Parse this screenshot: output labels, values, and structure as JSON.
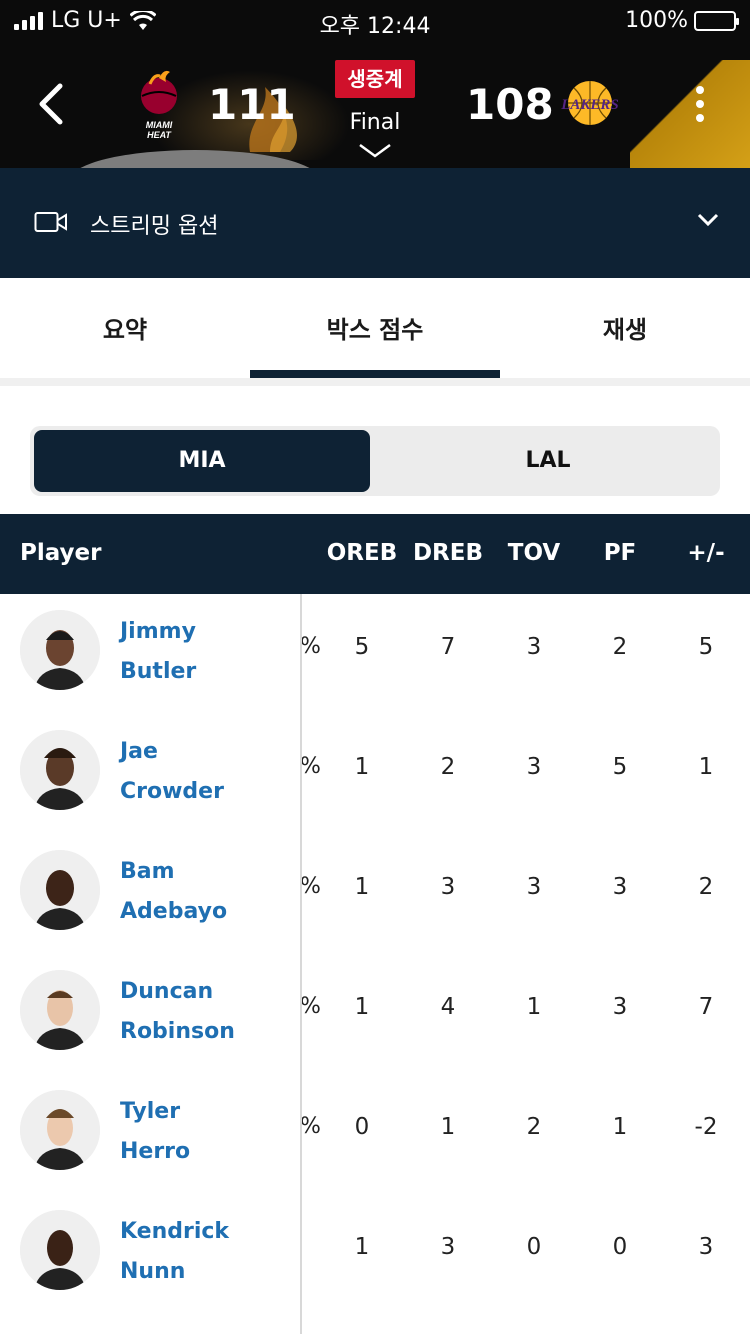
{
  "status_bar": {
    "carrier": "LG U+",
    "time": "오후 12:44",
    "battery": "100%"
  },
  "game": {
    "home_score": "111",
    "away_score": "108",
    "live_label": "생중계",
    "status": "Final",
    "home_team_logo": "miami-heat-logo",
    "home_logo_text_1": "MIAMI",
    "home_logo_text_2": "HEAT",
    "away_team_logo": "los-angeles-lakers-logo",
    "away_logo_text": "LAKERS"
  },
  "streaming": {
    "label": "스트리밍 옵션"
  },
  "tabs": [
    {
      "label": "요약",
      "active": false
    },
    {
      "label": "박스 점수",
      "active": true
    },
    {
      "label": "재생",
      "active": false
    }
  ],
  "team_toggle": {
    "home": "MIA",
    "away": "LAL",
    "selected": "MIA"
  },
  "table": {
    "player_header": "Player",
    "columns": [
      "OREB",
      "DREB",
      "TOV",
      "PF",
      "+/-"
    ],
    "rows": [
      {
        "first": "Jimmy",
        "last": "Butler",
        "cut": "%",
        "stats": [
          "5",
          "7",
          "3",
          "2",
          "5"
        ]
      },
      {
        "first": "Jae",
        "last": "Crowder",
        "cut": "%",
        "stats": [
          "1",
          "2",
          "3",
          "5",
          "1"
        ]
      },
      {
        "first": "Bam",
        "last": "Adebayo",
        "cut": "%",
        "stats": [
          "1",
          "3",
          "3",
          "3",
          "2"
        ]
      },
      {
        "first": "Duncan",
        "last": "Robinson",
        "cut": "%",
        "stats": [
          "1",
          "4",
          "1",
          "3",
          "7"
        ]
      },
      {
        "first": "Tyler",
        "last": "Herro",
        "cut": "%",
        "stats": [
          "0",
          "1",
          "2",
          "1",
          "-2"
        ]
      },
      {
        "first": "Kendrick",
        "last": "Nunn",
        "cut": "",
        "stats": [
          "1",
          "3",
          "0",
          "0",
          "3"
        ]
      }
    ]
  },
  "colors": {
    "navy": "#0e2234",
    "live_red": "#d0112b",
    "link_blue": "#1f6fb2",
    "heat_red": "#98002e",
    "lakers_purple": "#552583",
    "lakers_gold": "#fdb927"
  }
}
